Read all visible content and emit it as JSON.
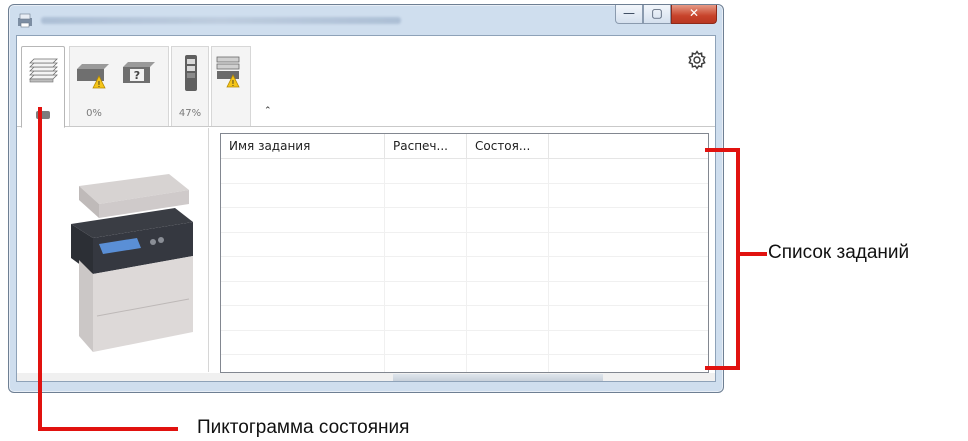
{
  "window": {
    "title_visible": false,
    "buttons": {
      "minimize": "—",
      "maximize": "▢",
      "close": "✕"
    }
  },
  "toolbar": {
    "tabs": [
      {
        "name": "printer-status",
        "icon": "stacked-pages-icon",
        "label": ""
      },
      {
        "name": "toner",
        "icon": "toner-warning-icon",
        "label": "0%"
      },
      {
        "name": "paper",
        "icon": "paper-tray-icon",
        "label": "47%"
      },
      {
        "name": "device",
        "icon": "scanner-warning-icon",
        "label": ""
      }
    ],
    "collapse_icon": "chevron-up-icon",
    "settings_icon": "gear-icon"
  },
  "job_list": {
    "columns": [
      "Имя задания",
      "Распеч...",
      "Состоя...",
      ""
    ],
    "rows": 9
  },
  "callouts": {
    "job_list": "Список заданий",
    "status_icon": "Пиктограмма состояния"
  },
  "colors": {
    "callout_line": "#e1120f",
    "window_frame": "#cfdeee",
    "close_button": "#c7432b",
    "warning": "#f5c518"
  }
}
